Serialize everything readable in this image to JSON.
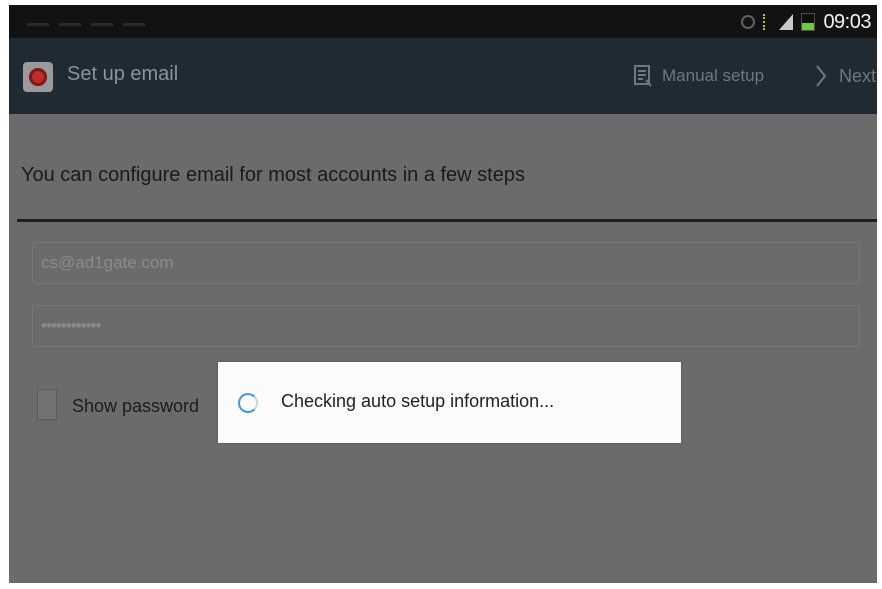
{
  "status_bar": {
    "time": "09:03",
    "icons": [
      "vibrate-icon",
      "signal-activity-icon",
      "signal-strength-icon",
      "battery-icon"
    ]
  },
  "action_bar": {
    "app_icon": "email-app-icon",
    "title": "Set up email",
    "manual_setup_label": "Manual setup",
    "next_label": "Next"
  },
  "main": {
    "intro_text": "You can configure email for most accounts in a few steps",
    "email_value": "cs@ad1gate.com",
    "password_value": "••••••••••••",
    "show_password_label": "Show password",
    "show_password_checked": false
  },
  "dialog": {
    "message": "Checking auto setup information..."
  },
  "colors": {
    "action_bar": "#1f2a33",
    "overlay_background": "#6b6b6b",
    "spinner": "#3f9ad6"
  }
}
